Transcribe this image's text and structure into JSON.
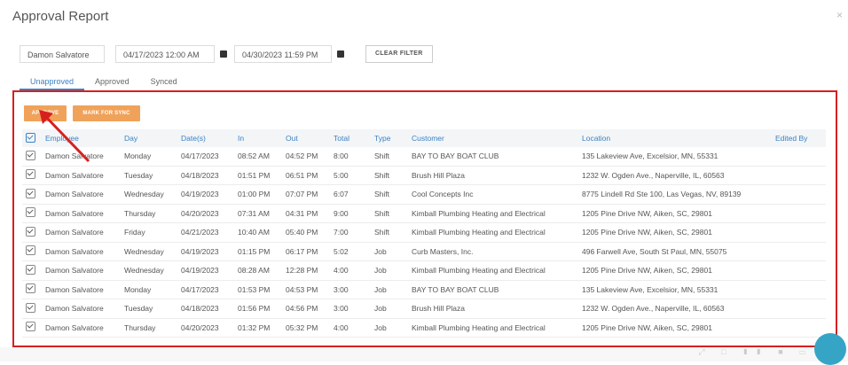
{
  "window": {
    "title": "Approval Report",
    "close": "×"
  },
  "filters": {
    "employee": "Damon Salvatore",
    "start": "04/17/2023 12:00 AM",
    "end": "04/30/2023 11:59 PM",
    "clear_label": "CLEAR FILTER"
  },
  "tabs": [
    {
      "label": "Unapproved",
      "active": true
    },
    {
      "label": "Approved",
      "active": false
    },
    {
      "label": "Synced",
      "active": false
    }
  ],
  "actions": {
    "approve_label": "APPROVE",
    "sync_label": "MARK FOR SYNC"
  },
  "table": {
    "columns": [
      "Employee",
      "Day",
      "Date(s)",
      "In",
      "Out",
      "Total",
      "Type",
      "Customer",
      "Location",
      "Edited By"
    ],
    "rows": [
      [
        "Damon Salvatore",
        "Monday",
        "04/17/2023",
        "08:52 AM",
        "04:52 PM",
        "8:00",
        "Shift",
        "BAY TO BAY BOAT CLUB",
        "135 Lakeview Ave, Excelsior, MN, 55331",
        ""
      ],
      [
        "Damon Salvatore",
        "Tuesday",
        "04/18/2023",
        "01:51 PM",
        "06:51 PM",
        "5:00",
        "Shift",
        "Brush Hill Plaza",
        "1232 W. Ogden Ave., Naperville, IL, 60563",
        ""
      ],
      [
        "Damon Salvatore",
        "Wednesday",
        "04/19/2023",
        "01:00 PM",
        "07:07 PM",
        "6:07",
        "Shift",
        "Cool Concepts Inc",
        "8775 Lindell Rd Ste 100, Las Vegas, NV, 89139",
        ""
      ],
      [
        "Damon Salvatore",
        "Thursday",
        "04/20/2023",
        "07:31 AM",
        "04:31 PM",
        "9:00",
        "Shift",
        "Kimball Plumbing Heating and Electrical",
        "1205 Pine Drive NW, Aiken, SC, 29801",
        ""
      ],
      [
        "Damon Salvatore",
        "Friday",
        "04/21/2023",
        "10:40 AM",
        "05:40 PM",
        "7:00",
        "Shift",
        "Kimball Plumbing Heating and Electrical",
        "1205 Pine Drive NW, Aiken, SC, 29801",
        ""
      ],
      [
        "Damon Salvatore",
        "Wednesday",
        "04/19/2023",
        "01:15 PM",
        "06:17 PM",
        "5:02",
        "Job",
        "Curb Masters, Inc.",
        "496 Farwell Ave, South St Paul, MN, 55075",
        ""
      ],
      [
        "Damon Salvatore",
        "Wednesday",
        "04/19/2023",
        "08:28 AM",
        "12:28 PM",
        "4:00",
        "Job",
        "Kimball Plumbing Heating and Electrical",
        "1205 Pine Drive NW, Aiken, SC, 29801",
        ""
      ],
      [
        "Damon Salvatore",
        "Monday",
        "04/17/2023",
        "01:53 PM",
        "04:53 PM",
        "3:00",
        "Job",
        "BAY TO BAY BOAT CLUB",
        "135 Lakeview Ave, Excelsior, MN, 55331",
        ""
      ],
      [
        "Damon Salvatore",
        "Tuesday",
        "04/18/2023",
        "01:56 PM",
        "04:56 PM",
        "3:00",
        "Job",
        "Brush Hill Plaza",
        "1232 W. Ogden Ave., Naperville, IL, 60563",
        ""
      ],
      [
        "Damon Salvatore",
        "Thursday",
        "04/20/2023",
        "01:32 PM",
        "05:32 PM",
        "4:00",
        "Job",
        "Kimball Plumbing Heating and Electrical",
        "1205 Pine Drive NW, Aiken, SC, 29801",
        ""
      ]
    ]
  },
  "colors": {
    "accent": "#3b82c4",
    "action": "#f0a25a",
    "highlight": "#d62020"
  }
}
